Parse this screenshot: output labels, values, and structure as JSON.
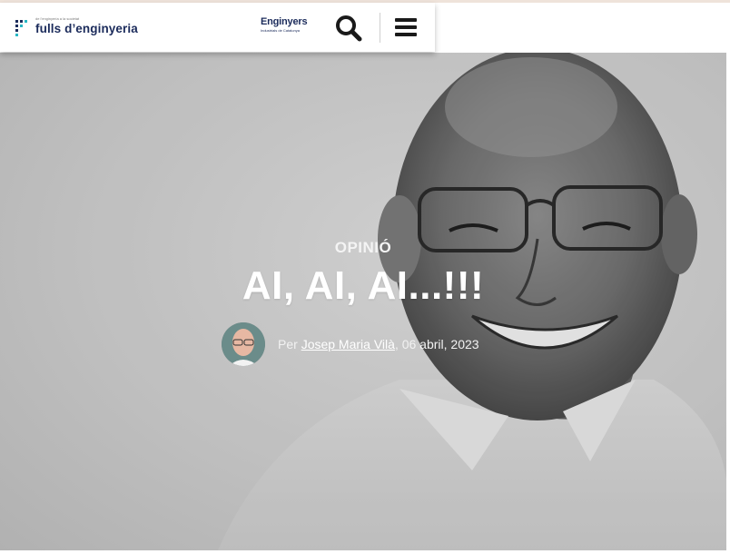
{
  "header": {
    "logo_text": "fulls d’enginyeria",
    "logo_tagline": "de l'enginyeria a la societat",
    "partner_logo_main": "Enginyers",
    "partner_logo_sub": "Industrials de Catalunya",
    "search_icon": "search-icon",
    "menu_icon": "hamburger-menu-icon"
  },
  "article": {
    "category": "OPINIÓ",
    "title": "AI, AI, AI...!!!",
    "byline_prefix": "Per ",
    "author": "Josep Maria Vilà",
    "date_text": ", 06 abril, 2023"
  },
  "colors": {
    "brand_navy": "#1b2b5b",
    "logo_teal": "#27b7c4",
    "header_bg": "#ffffff"
  }
}
